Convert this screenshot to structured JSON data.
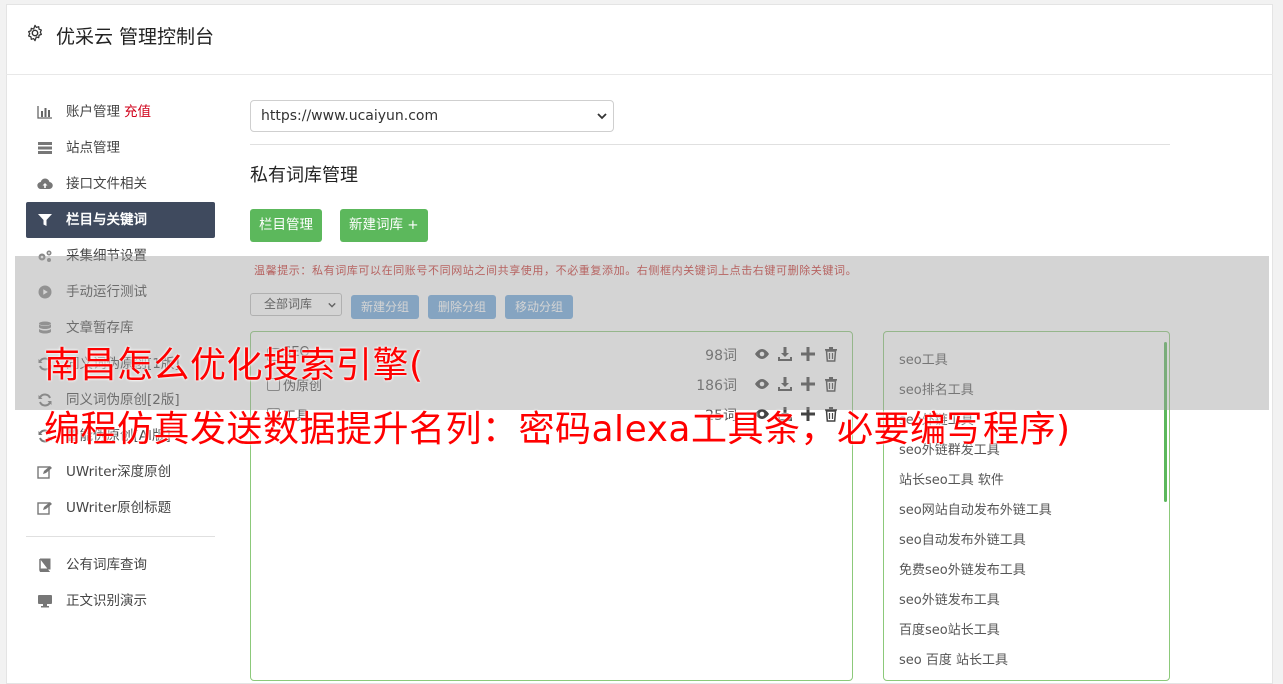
{
  "header": {
    "title": "优采云 管理控制台",
    "icon": "gear-icon"
  },
  "sidebar": {
    "items": [
      {
        "label": "账户管理",
        "extra": "充值",
        "icon": "bar-chart-icon"
      },
      {
        "label": "站点管理",
        "icon": "server-icon"
      },
      {
        "label": "接口文件相关",
        "icon": "cloud-upload-icon"
      },
      {
        "label": "栏目与关键词",
        "icon": "filter-icon",
        "active": true
      },
      {
        "label": "采集细节设置",
        "icon": "gears-icon"
      },
      {
        "label": "手动运行测试",
        "icon": "play-circle-icon"
      },
      {
        "label": "文章暂存库",
        "icon": "database-icon"
      },
      {
        "label": "同义词伪原创[1版]",
        "icon": "refresh-icon"
      },
      {
        "label": "同义词伪原创[2版]",
        "icon": "refresh-icon"
      },
      {
        "label": "智能伪原创[AI版]",
        "icon": "refresh-icon"
      },
      {
        "label": "UWriter深度原创",
        "icon": "edit-icon"
      },
      {
        "label": "UWriter原创标题",
        "icon": "edit-icon"
      },
      {
        "label": "公有词库查询",
        "icon": "book-icon"
      },
      {
        "label": "正文识别演示",
        "icon": "monitor-icon"
      }
    ]
  },
  "main": {
    "site_select": "https://www.ucaiyun.com",
    "section_title": "私有词库管理",
    "btn_columns": "栏目管理",
    "btn_new_lib": "新建词库 +",
    "tip": "温馨提示：私有词库可以在同账号不同网站之间共享使用，不必重复添加。右侧框内关键词上点击右键可删除关键词。",
    "filter_select": "全部词库",
    "btn_new_group": "新建分组",
    "btn_delete_group": "删除分组",
    "btn_move_group": "移动分组",
    "libraries": [
      {
        "name": "SEO",
        "count": "98词"
      },
      {
        "name": "伪原创",
        "count": "186词"
      },
      {
        "name": "工具",
        "count": "25词"
      }
    ],
    "keywords": [
      "seo工具",
      "seo排名工具",
      "seo外链工具",
      "seo外链群发工具",
      "站长seo工具 软件",
      "seo网站自动发布外链工具",
      "seo自动发布外链工具",
      "免费seo外链发布工具",
      "seo外链发布工具",
      "百度seo站长工具",
      "seo 百度 站长工具"
    ]
  },
  "overlay": {
    "line1": "南昌怎么优化搜索引擎(",
    "line2": "编程仿真发送数据提升名列：密码alexa工具条，必要编写程序)"
  },
  "colors": {
    "accent_green": "#5cb85c",
    "active_nav": "#3f4a5e",
    "overlay_text": "#ff0000",
    "charge": "#d0021b"
  }
}
